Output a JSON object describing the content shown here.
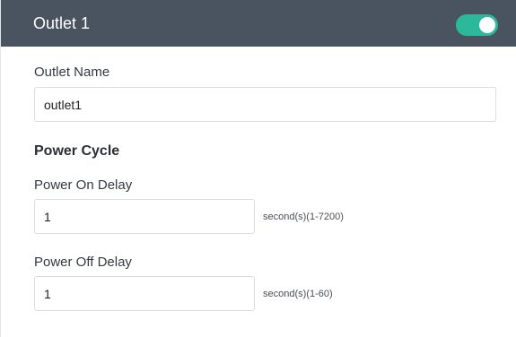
{
  "header": {
    "title": "Outlet 1",
    "toggle_enabled": true,
    "toggle_color": "#2bb89b",
    "bar_color": "#4a5360"
  },
  "outlet_name": {
    "label": "Outlet Name",
    "value": "outlet1"
  },
  "power_cycle": {
    "title": "Power Cycle",
    "on_delay": {
      "label": "Power On Delay",
      "value": "1",
      "hint": "second(s)(1-7200)"
    },
    "off_delay": {
      "label": "Power Off Delay",
      "value": "1",
      "hint": "second(s)(1-60)"
    }
  }
}
